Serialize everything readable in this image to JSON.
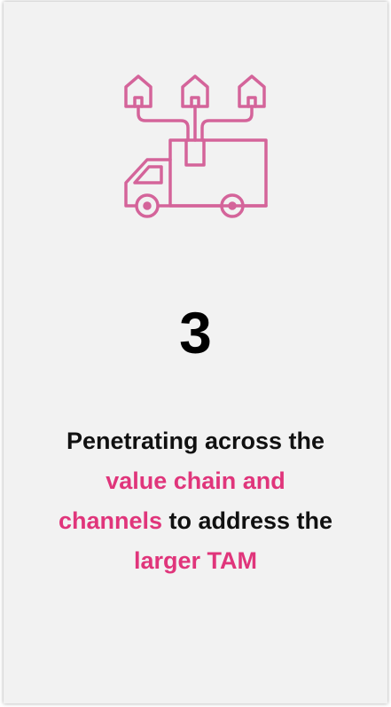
{
  "card": {
    "icon": "delivery-truck-with-houses-icon",
    "number": "3",
    "description": {
      "line1": "Penetrating across the",
      "line2_highlight": "value chain and",
      "line3_highlight": "channels",
      "line3_rest": " to address the",
      "line4_highlight": "larger TAM"
    }
  },
  "colors": {
    "accent": "#e0357b",
    "icon_stroke": "#d4649a",
    "card_background": "#f2f2f2",
    "text": "#111111"
  }
}
